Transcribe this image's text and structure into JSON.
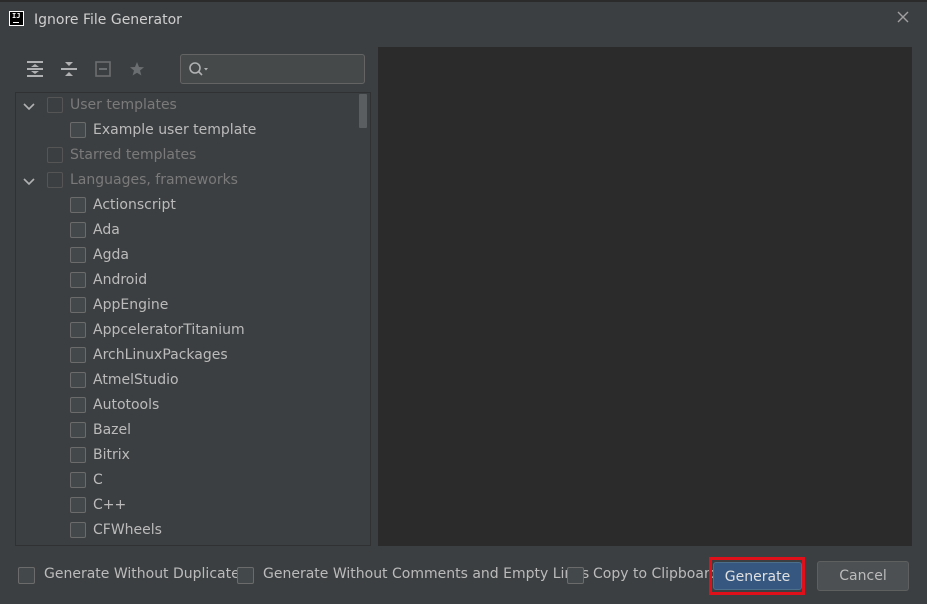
{
  "window": {
    "title": "Ignore File Generator",
    "app_icon_text": "IJ"
  },
  "toolbar": {
    "search_placeholder": "",
    "icons": [
      "expand-all-icon",
      "collapse-all-icon",
      "unselect-all-icon",
      "star-icon",
      "search-icon"
    ]
  },
  "tree": {
    "items": [
      {
        "label": "User templates",
        "level": 0,
        "expandable": true,
        "dim": true
      },
      {
        "label": "Example user template",
        "level": 1,
        "expandable": false,
        "dim": false
      },
      {
        "label": "Starred templates",
        "level": 0,
        "expandable": false,
        "dim": true
      },
      {
        "label": "Languages, frameworks",
        "level": 0,
        "expandable": true,
        "dim": true
      },
      {
        "label": "Actionscript",
        "level": 1,
        "expandable": false,
        "dim": false
      },
      {
        "label": "Ada",
        "level": 1,
        "expandable": false,
        "dim": false
      },
      {
        "label": "Agda",
        "level": 1,
        "expandable": false,
        "dim": false
      },
      {
        "label": "Android",
        "level": 1,
        "expandable": false,
        "dim": false
      },
      {
        "label": "AppEngine",
        "level": 1,
        "expandable": false,
        "dim": false
      },
      {
        "label": "AppceleratorTitanium",
        "level": 1,
        "expandable": false,
        "dim": false
      },
      {
        "label": "ArchLinuxPackages",
        "level": 1,
        "expandable": false,
        "dim": false
      },
      {
        "label": "AtmelStudio",
        "level": 1,
        "expandable": false,
        "dim": false
      },
      {
        "label": "Autotools",
        "level": 1,
        "expandable": false,
        "dim": false
      },
      {
        "label": "Bazel",
        "level": 1,
        "expandable": false,
        "dim": false
      },
      {
        "label": "Bitrix",
        "level": 1,
        "expandable": false,
        "dim": false
      },
      {
        "label": "C",
        "level": 1,
        "expandable": false,
        "dim": false
      },
      {
        "label": "C++",
        "level": 1,
        "expandable": false,
        "dim": false
      },
      {
        "label": "CFWheels",
        "level": 1,
        "expandable": false,
        "dim": false
      }
    ]
  },
  "options": {
    "without_duplicates": "Generate Without Duplicates",
    "without_comments": "Generate Without Comments and Empty Lines",
    "copy_clipboard": "Copy to Clipboard"
  },
  "buttons": {
    "generate": "Generate",
    "cancel": "Cancel"
  },
  "colors": {
    "background": "#3c3f41",
    "preview_background": "#2b2b2b",
    "primary_button": "#365880",
    "highlight": "#e0101b"
  }
}
